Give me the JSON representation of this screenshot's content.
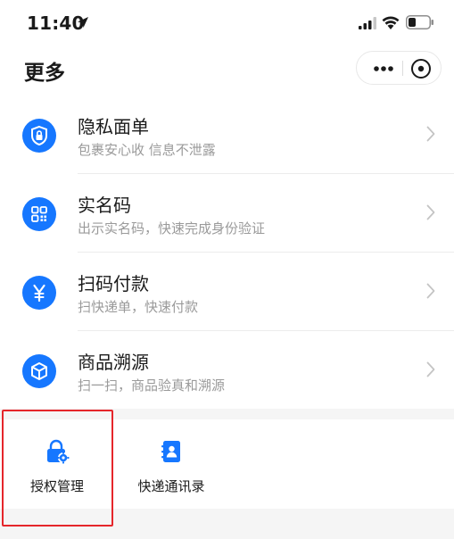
{
  "status_bar": {
    "time": "11:40"
  },
  "header": {
    "title": "更多"
  },
  "list": [
    {
      "title": "隐私面单",
      "subtitle": "包裹安心收 信息不泄露",
      "icon": "shield-lock-icon"
    },
    {
      "title": "实名码",
      "subtitle": "出示实名码，快速完成身份验证",
      "icon": "qr-code-icon"
    },
    {
      "title": "扫码付款",
      "subtitle": "扫快递单，快速付款",
      "icon": "yen-icon"
    },
    {
      "title": "商品溯源",
      "subtitle": "扫一扫，商品验真和溯源",
      "icon": "box-icon"
    }
  ],
  "tiles": [
    {
      "label": "授权管理",
      "icon": "lock-gear-icon"
    },
    {
      "label": "快递通讯录",
      "icon": "contacts-book-icon"
    }
  ],
  "colors": {
    "accent": "#1677ff",
    "highlight": "#e5262b"
  }
}
